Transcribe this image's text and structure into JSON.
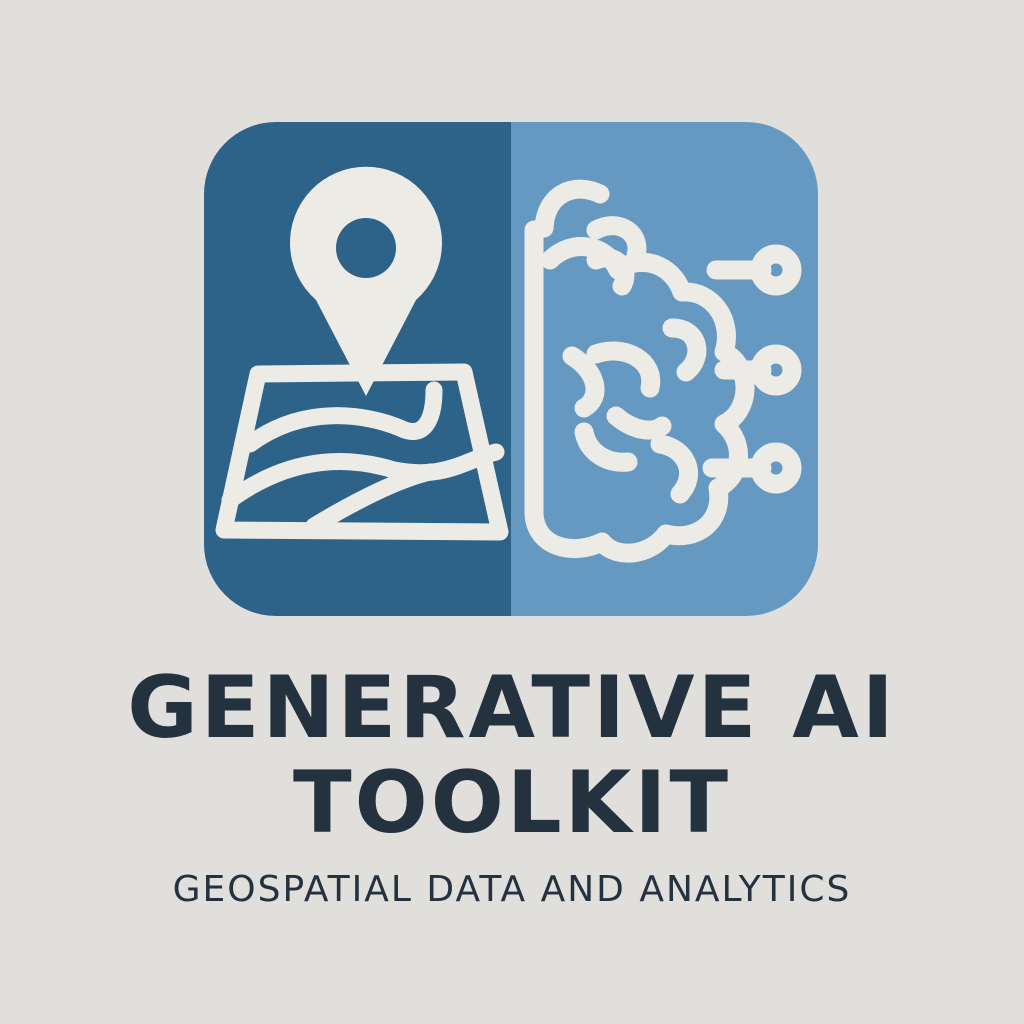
{
  "logo": {
    "title_line_1": "GENERATIVE AI",
    "title_line_2": "TOOLKIT",
    "tagline": "GEOSPATIAL DATA AND ANALYTICS",
    "icons": [
      "map-pin-icon",
      "map-icon",
      "brain-circuit-icon"
    ],
    "colors": {
      "background": "#e1dfdc",
      "panel_dark": "#2d6289",
      "panel_light": "#6699c2",
      "icon_stroke": "#ecebe6",
      "text": "#243240"
    }
  }
}
